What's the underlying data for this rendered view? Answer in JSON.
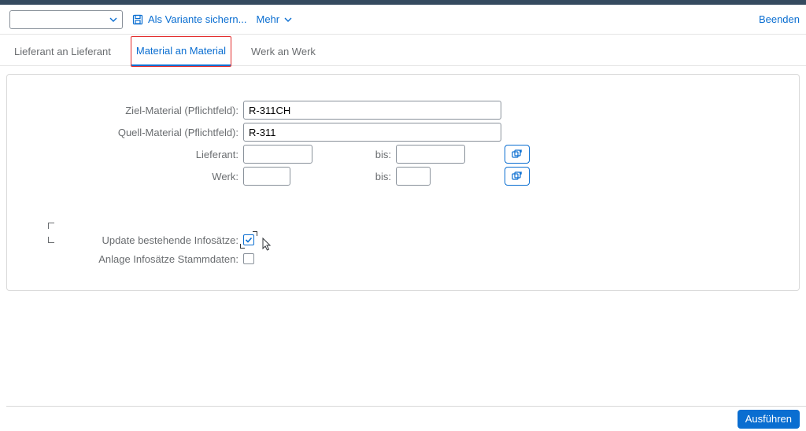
{
  "toolbar": {
    "variant_value": "",
    "save_variant_label": "Als Variante sichern...",
    "more_label": "Mehr",
    "exit_label": "Beenden"
  },
  "tabs": [
    {
      "label": "Lieferant an Lieferant"
    },
    {
      "label": "Material an Material"
    },
    {
      "label": "Werk an Werk"
    }
  ],
  "active_tab": 1,
  "form": {
    "ziel_material_label": "Ziel-Material (Pflichtfeld):",
    "ziel_material_value": "R-311CH",
    "quell_material_label": "Quell-Material (Pflichtfeld):",
    "quell_material_value": "R-311",
    "lieferant_label": "Lieferant:",
    "lieferant_from": "",
    "lieferant_bis_label": "bis:",
    "lieferant_to": "",
    "werk_label": "Werk:",
    "werk_from": "",
    "werk_bis_label": "bis:",
    "werk_to": ""
  },
  "checkboxes": {
    "update_label": "Update bestehende Infosätze:",
    "update_checked": true,
    "anlage_label": "Anlage Infosätze Stammdaten:",
    "anlage_checked": false
  },
  "footer": {
    "execute_label": "Ausführen"
  }
}
